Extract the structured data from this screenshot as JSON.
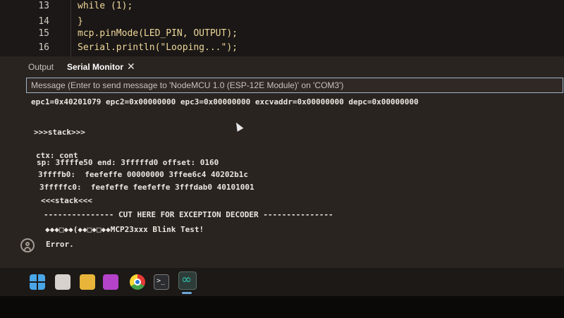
{
  "editor": {
    "lines": [
      {
        "num": "13",
        "code": "    while (1);"
      },
      {
        "num": "14",
        "code": "  }"
      },
      {
        "num": "15",
        "code": "  mcp.pinMode(LED_PIN, OUTPUT);"
      },
      {
        "num": "16",
        "code": "  Serial.println(\"Looping...\");"
      }
    ]
  },
  "panel": {
    "tabs": [
      {
        "label": "Output",
        "active": false
      },
      {
        "label": "Serial Monitor",
        "active": true
      }
    ],
    "close_glyph": "✕"
  },
  "serial": {
    "input_placeholder": "Message (Enter to send message to 'NodeMCU 1.0 (ESP-12E Module)' on 'COM3')",
    "lines": [
      "epc1=0x40201079 epc2=0x00000000 epc3=0x00000000 excvaddr=0x00000000 depc=0x00000000",
      "",
      ">>>stack>>>",
      "",
      "ctx: cont",
      "sp: 3ffffe50 end: 3fffffd0 offset: 0160",
      "3ffffb0:  feefeffe 00000000 3ffee6c4 40202b1c",
      "3fffffc0:  feefeffe feefeffe 3fffdab0 40101001",
      "<<<stack<<<",
      "",
      "--------------- CUT HERE FOR EXCEPTION DECODER ---------------",
      "◆◆◆□◆◆(◆◆□◆□◆◆MCP23xxx Blink Test!",
      "Error."
    ]
  },
  "taskbar": {
    "icons": [
      "windows-start-icon",
      "snipping-tool-icon",
      "file-explorer-icon",
      "onenote-icon",
      "chrome-icon",
      "terminal-icon",
      "arduino-ide-icon"
    ]
  },
  "colors": {
    "editor_bg": "#1a1716",
    "panel_bg": "#2a2421",
    "accent": "#9fb6c8",
    "code_text": "#f0d79a"
  }
}
